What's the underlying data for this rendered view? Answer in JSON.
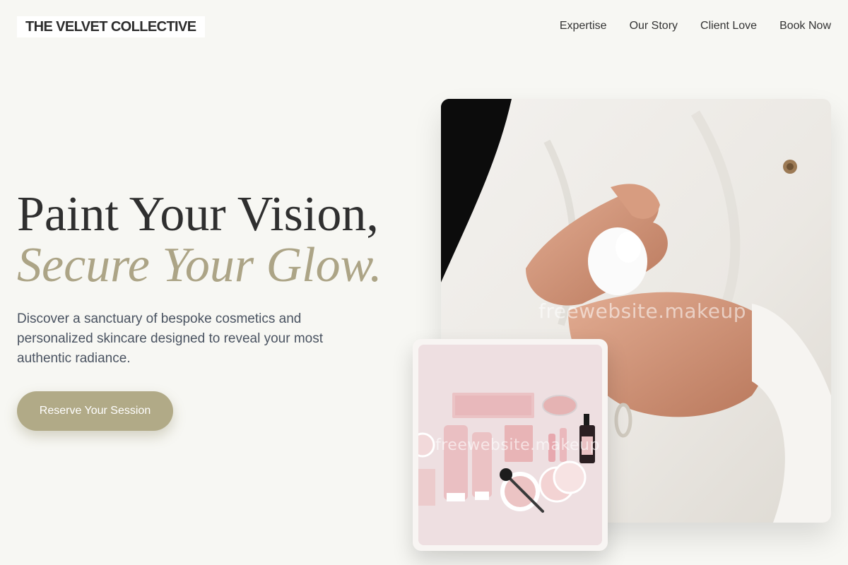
{
  "header": {
    "brand": "THE VELVET COLLECTIVE",
    "nav": [
      {
        "label": "Expertise"
      },
      {
        "label": "Our Story"
      },
      {
        "label": "Client Love"
      },
      {
        "label": "Book Now"
      }
    ]
  },
  "hero": {
    "headline_line1": "Paint Your Vision,",
    "headline_line2": "Secure Your Glow.",
    "description": "Discover a sanctuary of bespoke cosmetics and personalized skincare designed to reveal your most authentic radiance.",
    "cta_label": "Reserve Your Session"
  },
  "images": {
    "main_watermark": "freewebsite.makeup",
    "inset_watermark": "freewebsite.makeup"
  },
  "colors": {
    "background": "#f7f7f3",
    "accent": "#aca486",
    "cta": "#b1aa87",
    "text": "#2f2f2f",
    "body_text": "#4a5361"
  }
}
